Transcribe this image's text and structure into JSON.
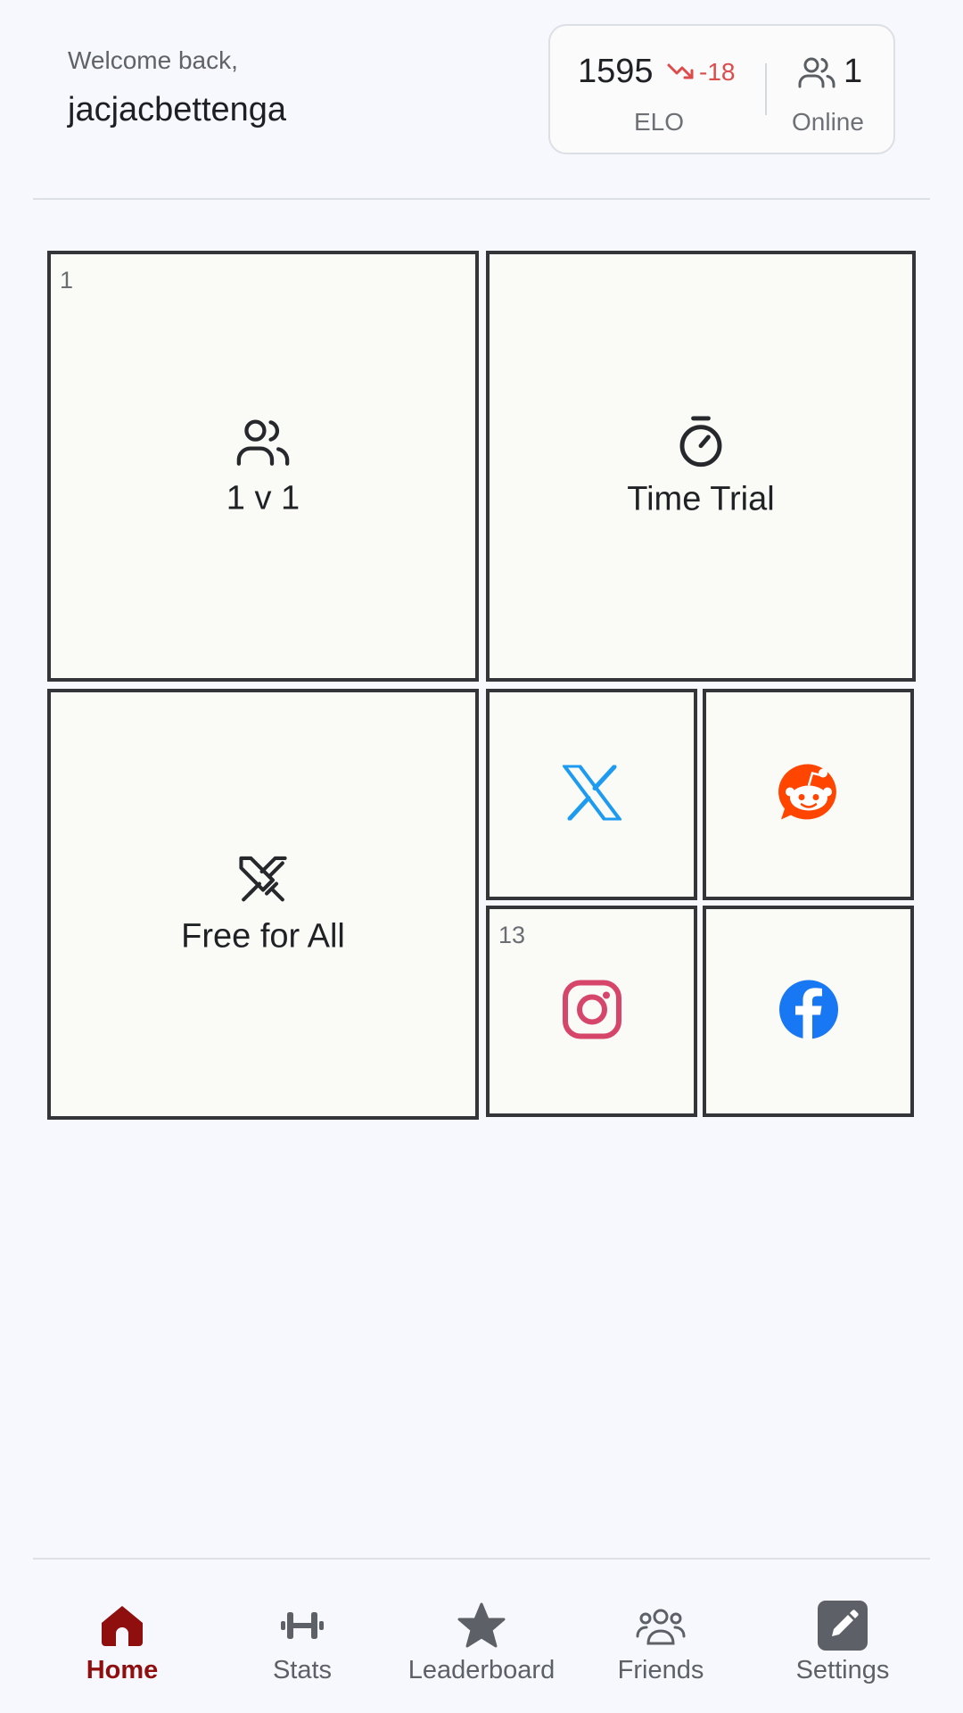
{
  "header": {
    "welcome": "Welcome back,",
    "username": "jacjacbettenga"
  },
  "stats": {
    "elo_value": "1595",
    "elo_delta": "-18",
    "elo_label": "ELO",
    "online_count": "1",
    "online_label": "Online"
  },
  "tiles": {
    "one_v_one": {
      "badge": "1",
      "label": "1 v 1",
      "icon": "users-icon"
    },
    "time_trial": {
      "label": "Time Trial",
      "icon": "stopwatch-icon"
    },
    "free_for_all": {
      "label": "Free for All",
      "icon": "crossed-swords-icon"
    },
    "x": {
      "icon": "x-logo-icon"
    },
    "reddit": {
      "icon": "reddit-logo-icon"
    },
    "instagram": {
      "badge": "13",
      "icon": "instagram-logo-icon"
    },
    "facebook": {
      "icon": "facebook-logo-icon"
    }
  },
  "nav": {
    "items": [
      {
        "label": "Home",
        "icon": "home-icon",
        "active": true
      },
      {
        "label": "Stats",
        "icon": "dumbbell-icon",
        "active": false
      },
      {
        "label": "Leaderboard",
        "icon": "star-icon",
        "active": false
      },
      {
        "label": "Friends",
        "icon": "friends-icon",
        "active": false
      },
      {
        "label": "Settings",
        "icon": "edit-icon",
        "active": false
      }
    ]
  },
  "colors": {
    "background": "#f6f8fe",
    "active_nav": "#8f0e0e",
    "elo_down": "#dd4b4b",
    "x_blue": "#1d9bf0",
    "reddit_orange": "#ff4500",
    "instagram_pink": "#d6456a",
    "facebook_blue": "#1877f2"
  }
}
